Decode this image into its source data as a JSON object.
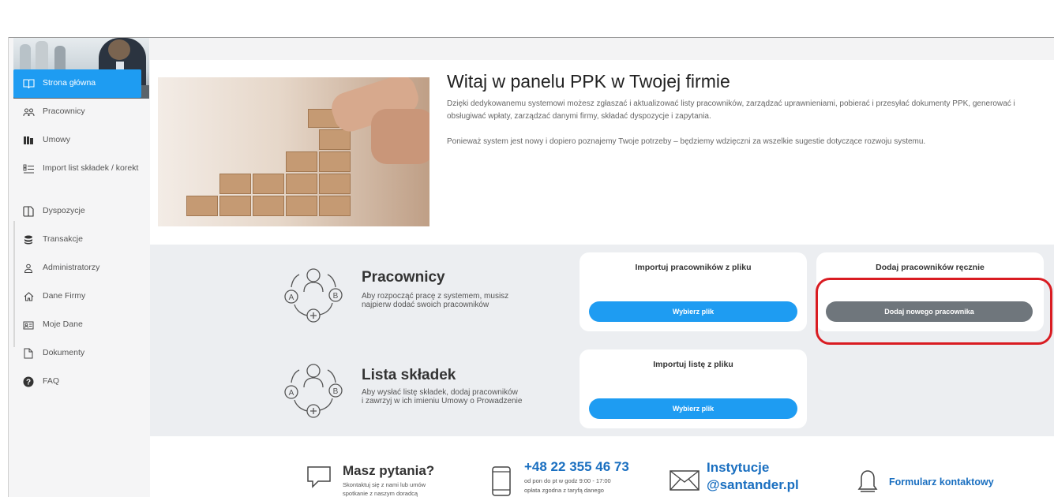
{
  "sidebar": {
    "items": [
      {
        "label": "Strona główna",
        "icon": "book-icon"
      },
      {
        "label": "Pracownicy",
        "icon": "users-icon"
      },
      {
        "label": "Umowy",
        "icon": "binder-icon"
      },
      {
        "label": "Import list składek / korekt",
        "icon": "list-import-icon"
      },
      {
        "label": "Dyspozycje",
        "icon": "documents-icon"
      },
      {
        "label": "Transakcje",
        "icon": "database-icon"
      },
      {
        "label": "Administratorzy",
        "icon": "person-icon"
      },
      {
        "label": "Dane Firmy",
        "icon": "home-icon"
      },
      {
        "label": "Moje Dane",
        "icon": "id-card-icon"
      },
      {
        "label": "Dokumenty",
        "icon": "file-icon"
      },
      {
        "label": "FAQ",
        "icon": "question-circle-icon"
      }
    ]
  },
  "welcome": {
    "title": "Witaj w panelu PPK w Twojej firmie",
    "p1": "Dzięki dedykowanemu systemowi możesz zgłaszać i aktualizować listy pracowników, zarządzać uprawnieniami, pobierać i przesyłać dokumenty PPK, generować i obsługiwać wpłaty, zarządzać danymi firmy, składać dyspozycje i zapytania.",
    "p2": "Ponieważ system jest nowy i dopiero poznajemy Twoje potrzeby – będziemy wdzięczni za wszelkie sugestie dotyczące rozwoju systemu."
  },
  "pracownicy": {
    "title": "Pracownicy",
    "desc_line1": "Aby rozpocząć pracę z systemem, musisz",
    "desc_line2": "najpierw dodać swoich pracowników",
    "import_card_title": "Importuj pracowników z pliku",
    "import_button": "Wybierz plik",
    "manual_card_title": "Dodaj pracowników ręcznie",
    "manual_button": "Dodaj nowego pracownika"
  },
  "lista": {
    "title": "Lista składek",
    "desc_line1": "Aby wysłać listę składek, dodaj pracowników",
    "desc_line2": "i zawrzyj w ich imieniu Umowy o Prowadzenie",
    "import_card_title": "Importuj listę z pliku",
    "import_button": "Wybierz plik"
  },
  "cycle_labels": {
    "a": "A",
    "b": "B"
  },
  "footer": {
    "questions_title": "Masz pytania?",
    "questions_sub1": "Skontaktuj się z nami lub umów",
    "questions_sub2": "spotkanie z naszym doradcą",
    "phone": "+48 22 355 46 73",
    "phone_sub1": "od pon do pt w godz 9:00 - 17:00",
    "phone_sub2": "opłata zgodna z taryfą danego",
    "email_line1": "Instytucje",
    "email_line2": "@santander.pl",
    "contact_form": "Formularz kontaktowy"
  },
  "colors": {
    "accent": "#1e9cf2",
    "highlight": "#d91c22",
    "button_grey": "#6f767c",
    "link": "#1a6fc0"
  }
}
